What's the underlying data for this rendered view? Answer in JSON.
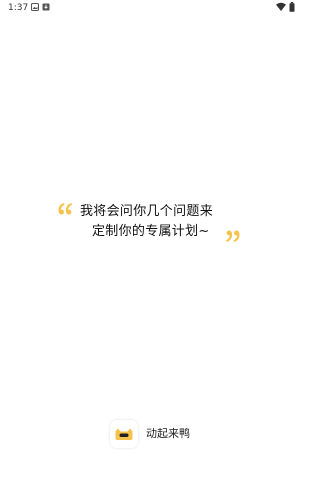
{
  "status_bar": {
    "time": "1:37",
    "icons": [
      "gallery-icon",
      "download-icon",
      "wifi-icon",
      "battery-icon"
    ]
  },
  "intro": {
    "line_1": "我将会问你几个问题来",
    "line_2": "定制你的专属计划~",
    "quote_color": "#F5C24B"
  },
  "brand": {
    "name": "动起来鸭",
    "logo_icon": "duck-logo-icon",
    "accent_color": "#F5C24B"
  }
}
